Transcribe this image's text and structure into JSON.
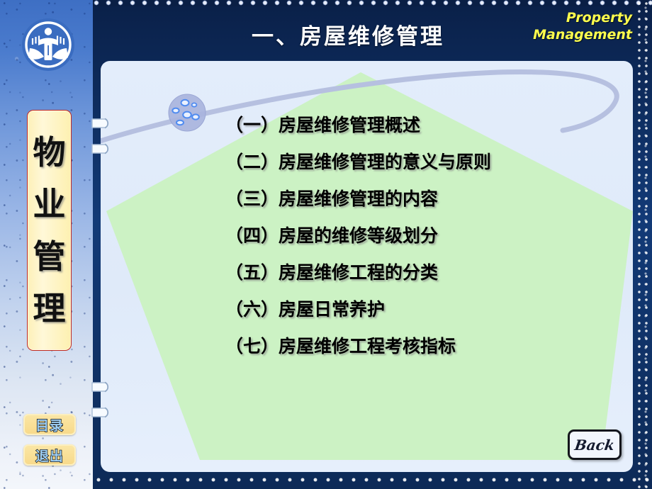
{
  "slide": {
    "header": {
      "title": "一、房屋维修管理",
      "brand_line1": "Property",
      "brand_line2": "Management",
      "brand_color": "#ffff4d",
      "logo_icon": "university-emblem-icon"
    },
    "sidebar": {
      "plaque_chars": [
        "物",
        "业",
        "管",
        "理"
      ],
      "plaque_bg": "#fdf3bd",
      "plaque_border": "#c02a20",
      "buttons": [
        {
          "name": "contents",
          "label": "目录"
        },
        {
          "name": "exit",
          "label": "退出"
        }
      ],
      "button_text_color": "#9fd0f5",
      "binding_rings": 4
    },
    "content": {
      "panel_bg": "#e1ebfa",
      "pentagon_color": "#ccf2c4",
      "swoosh_color": "#b6c0e0",
      "sphere_icon": "decorative-sphere-icon",
      "items": [
        "（一）房屋维修管理概述",
        "（二）房屋维修管理的意义与原则",
        "（三）房屋维修管理的内容",
        "（四）房屋的维修等级划分",
        "（五）房屋维修工程的分类",
        "（六）房屋日常养护",
        "（七）房屋维修工程考核指标"
      ]
    },
    "footer": {
      "back_label": "Back"
    }
  }
}
